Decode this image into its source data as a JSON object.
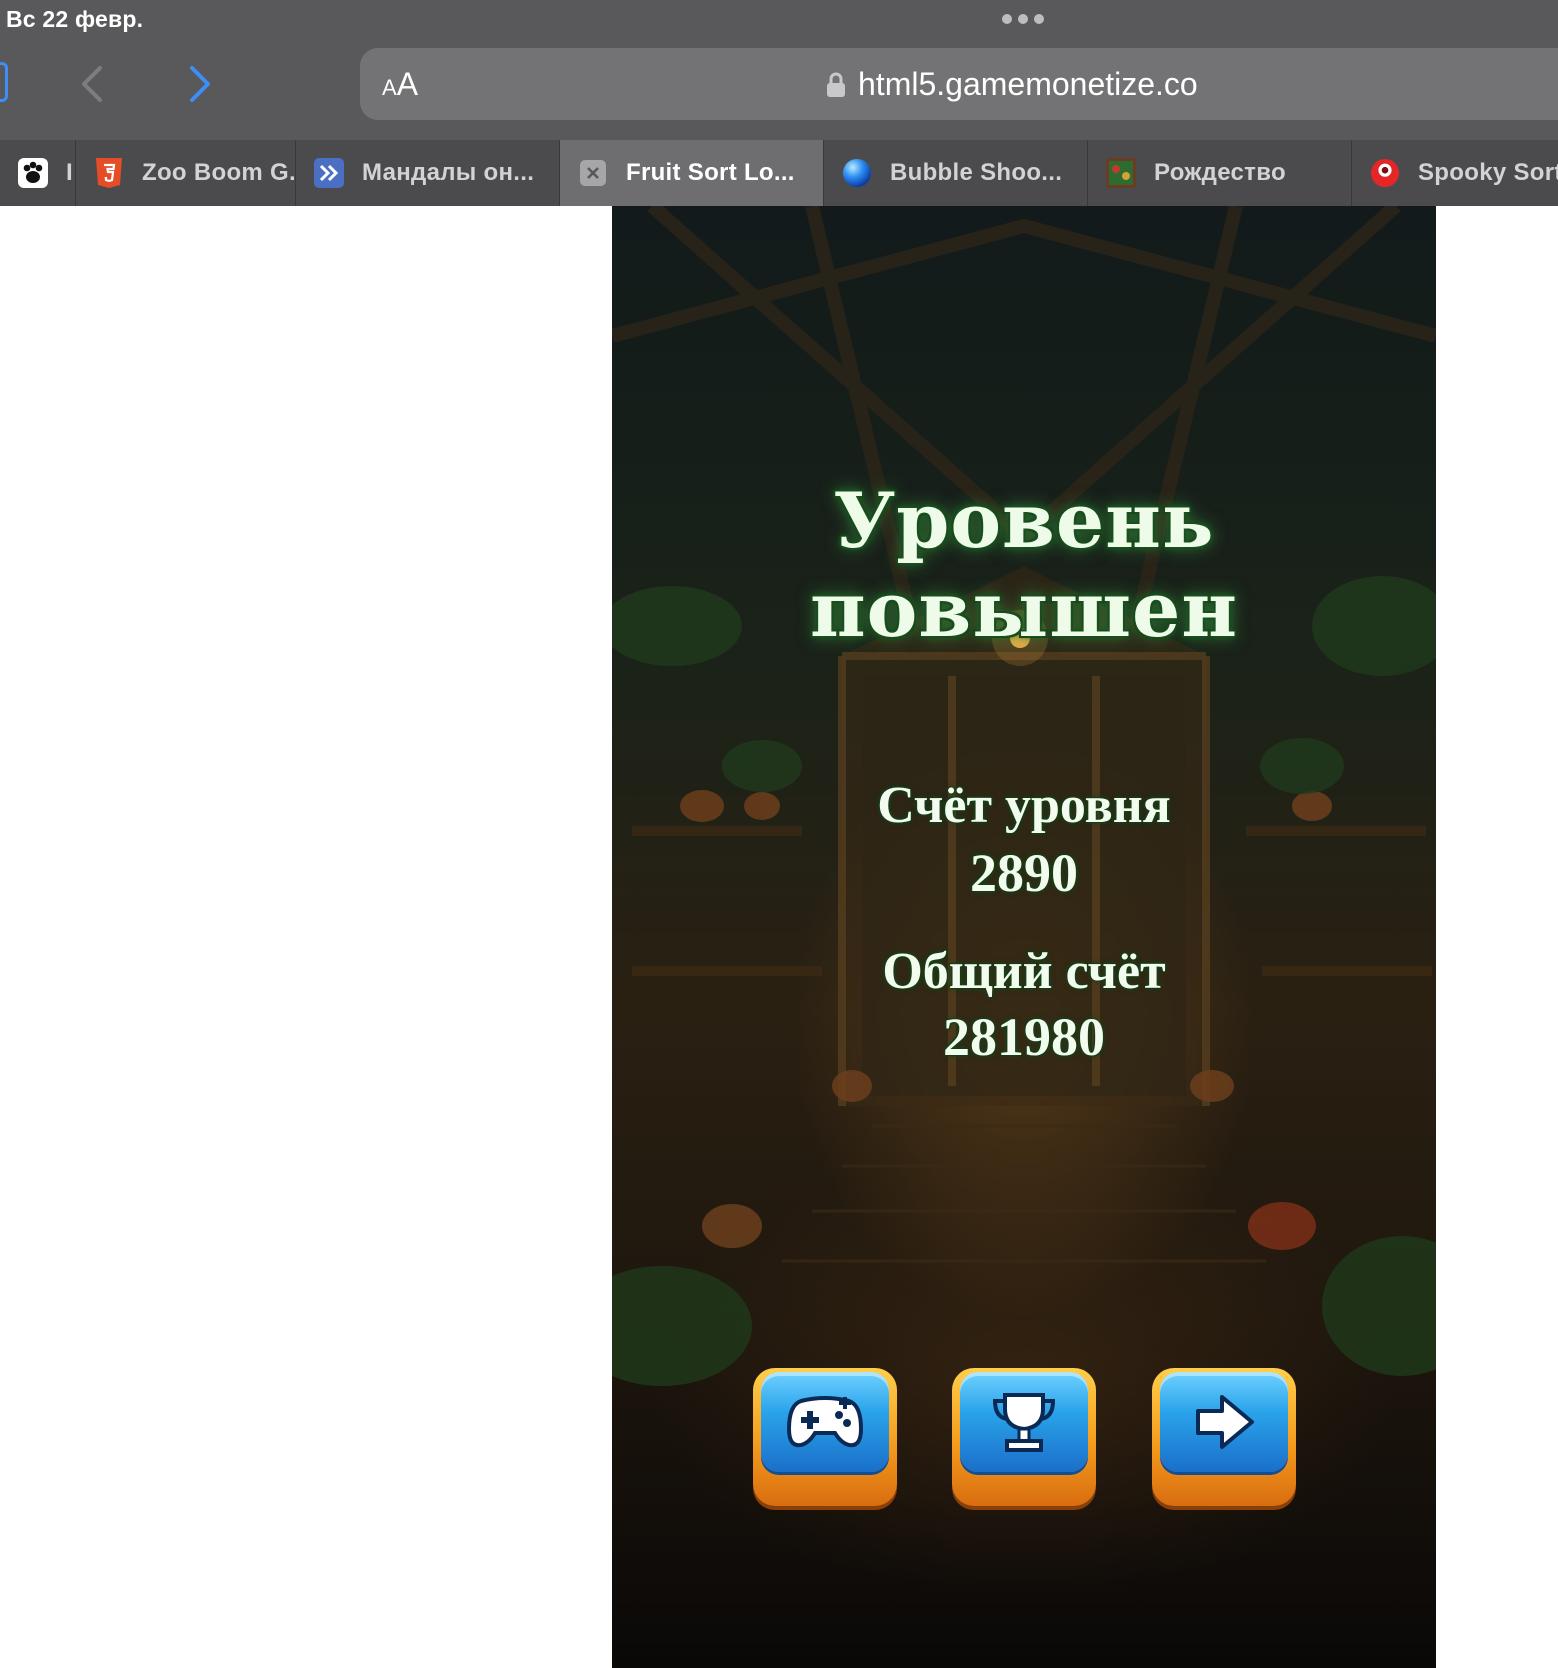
{
  "status": {
    "date": "Вс 22 февр."
  },
  "browser": {
    "reader_label_small": "A",
    "reader_label_large": "A",
    "url": "html5.gamemonetize.co"
  },
  "tabs": [
    {
      "title": "I",
      "favicon": "paw-icon"
    },
    {
      "title": "Zoo Boom G...",
      "favicon": "html5-icon"
    },
    {
      "title": "Мандалы он...",
      "favicon": "mandala-icon"
    },
    {
      "title": "Fruit Sort Lo...",
      "favicon": "close-icon",
      "active": true
    },
    {
      "title": "Bubble Shoo...",
      "favicon": "bubble-icon"
    },
    {
      "title": "Рождество",
      "favicon": "christmas-icon"
    },
    {
      "title": "Spooky Sort",
      "favicon": "spooky-icon"
    }
  ],
  "game": {
    "title": "Уровень повышен",
    "level_score_label": "Счёт уровня",
    "level_score_value": "2890",
    "total_score_label": "Общий счёт",
    "total_score_value": "281980",
    "buttons": [
      {
        "name": "play",
        "icon": "gamepad-icon"
      },
      {
        "name": "leaderboard",
        "icon": "trophy-icon"
      },
      {
        "name": "next-level",
        "icon": "arrow-right-icon"
      }
    ],
    "colors": {
      "title_glow": "#1e5a24",
      "button_blue": "#2aa3ea",
      "button_orange": "#f59c1d"
    }
  }
}
